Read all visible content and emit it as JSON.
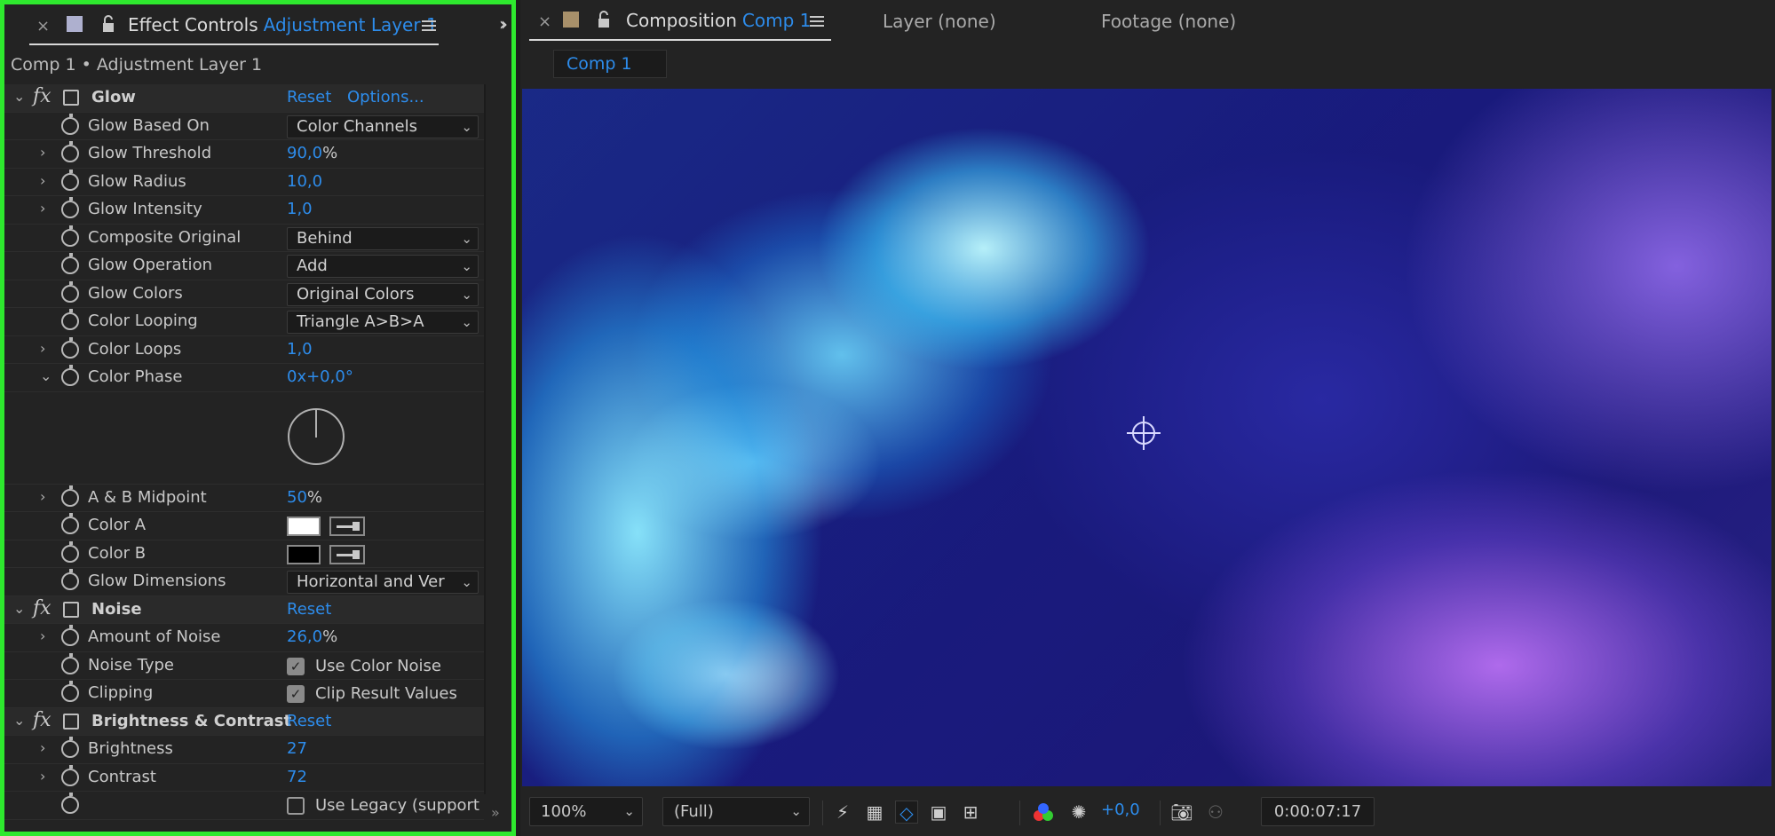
{
  "effect_controls": {
    "tab_title": "Effect Controls",
    "tab_layer": "Adjustment Layer 1",
    "breadcrumb": "Comp 1 • Adjustment Layer 1",
    "glow": {
      "name": "Glow",
      "reset": "Reset",
      "options": "Options...",
      "props": {
        "based_on_label": "Glow Based On",
        "based_on_value": "Color Channels",
        "threshold_label": "Glow Threshold",
        "threshold_value": "90,0",
        "threshold_unit": "%",
        "radius_label": "Glow Radius",
        "radius_value": "10,0",
        "intensity_label": "Glow Intensity",
        "intensity_value": "1,0",
        "composite_label": "Composite Original",
        "composite_value": "Behind",
        "operation_label": "Glow Operation",
        "operation_value": "Add",
        "colors_label": "Glow Colors",
        "colors_value": "Original Colors",
        "looping_label": "Color Looping",
        "looping_value": "Triangle A>B>A",
        "loops_label": "Color Loops",
        "loops_value": "1,0",
        "phase_label": "Color Phase",
        "phase_value": "0x+0,0°",
        "midpoint_label": "A & B Midpoint",
        "midpoint_value": "50",
        "midpoint_unit": "%",
        "color_a_label": "Color A",
        "color_a": "#ffffff",
        "color_b_label": "Color B",
        "color_b": "#000000",
        "dimensions_label": "Glow Dimensions",
        "dimensions_value": "Horizontal and Ver"
      }
    },
    "noise": {
      "name": "Noise",
      "reset": "Reset",
      "amount_label": "Amount of Noise",
      "amount_value": "26,0",
      "amount_unit": "%",
      "type_label": "Noise Type",
      "type_check_label": "Use Color Noise",
      "type_checked": true,
      "clipping_label": "Clipping",
      "clipping_check_label": "Clip Result Values",
      "clipping_checked": true
    },
    "brightness_contrast": {
      "name": "Brightness & Contrast",
      "reset": "Reset",
      "brightness_label": "Brightness",
      "brightness_value": "27",
      "contrast_label": "Contrast",
      "contrast_value": "72",
      "legacy_label": "Use Legacy (support",
      "legacy_checked": false
    }
  },
  "composition": {
    "tab_title": "Composition",
    "tab_comp": "Comp 1",
    "layer_tab": "Layer (none)",
    "footage_tab": "Footage (none)",
    "subtab": "Comp 1",
    "toolbar": {
      "zoom": "100%",
      "resolution": "(Full)",
      "exposure": "+0,0",
      "timecode": "0:00:07:17"
    }
  },
  "colors": {
    "accent": "#2d8ceb",
    "panel_highlight": "#2ee82e",
    "panel_bg": "#232323"
  }
}
